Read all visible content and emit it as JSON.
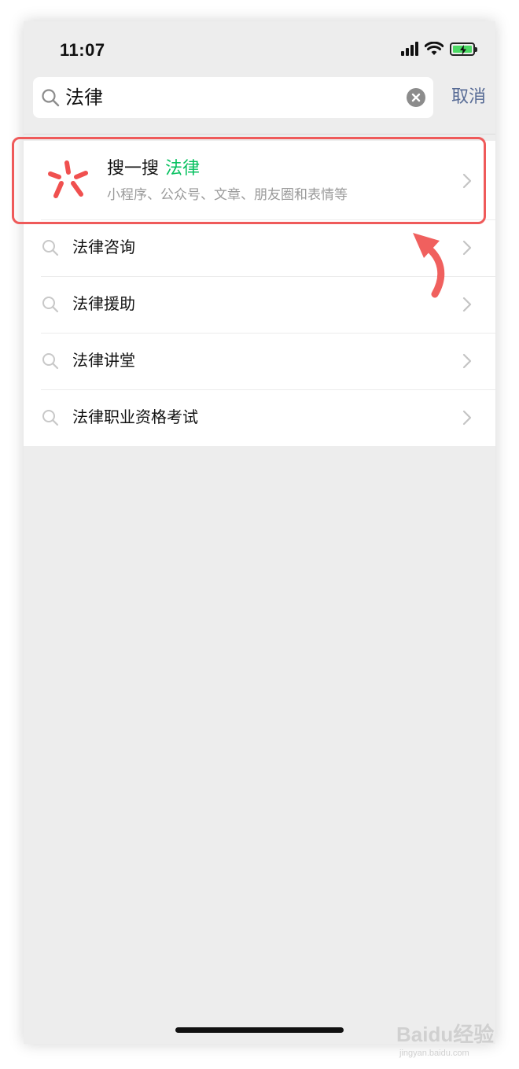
{
  "status_bar": {
    "time": "11:07"
  },
  "search": {
    "query": "法律",
    "cancel_label": "取消"
  },
  "sousou": {
    "title": "搜一搜",
    "keyword": "法律",
    "subtitle": "小程序、公众号、文章、朋友圈和表情等"
  },
  "suggestions": [
    {
      "label": "法律咨询"
    },
    {
      "label": "法律援助"
    },
    {
      "label": "法律讲堂"
    },
    {
      "label": "法律职业资格考试"
    }
  ],
  "colors": {
    "keyword_green": "#07c160",
    "cancel_blue": "#576b95",
    "annotation_red": "#ef5a5a",
    "sousou_logo_red": "#f0504f"
  },
  "icons": {
    "search": "magnifier-icon",
    "clear": "clear-circle-icon",
    "chevron": "chevron-right-icon"
  },
  "watermark": {
    "text": "Baidu经验",
    "sub": "jingyan.baidu.com"
  }
}
